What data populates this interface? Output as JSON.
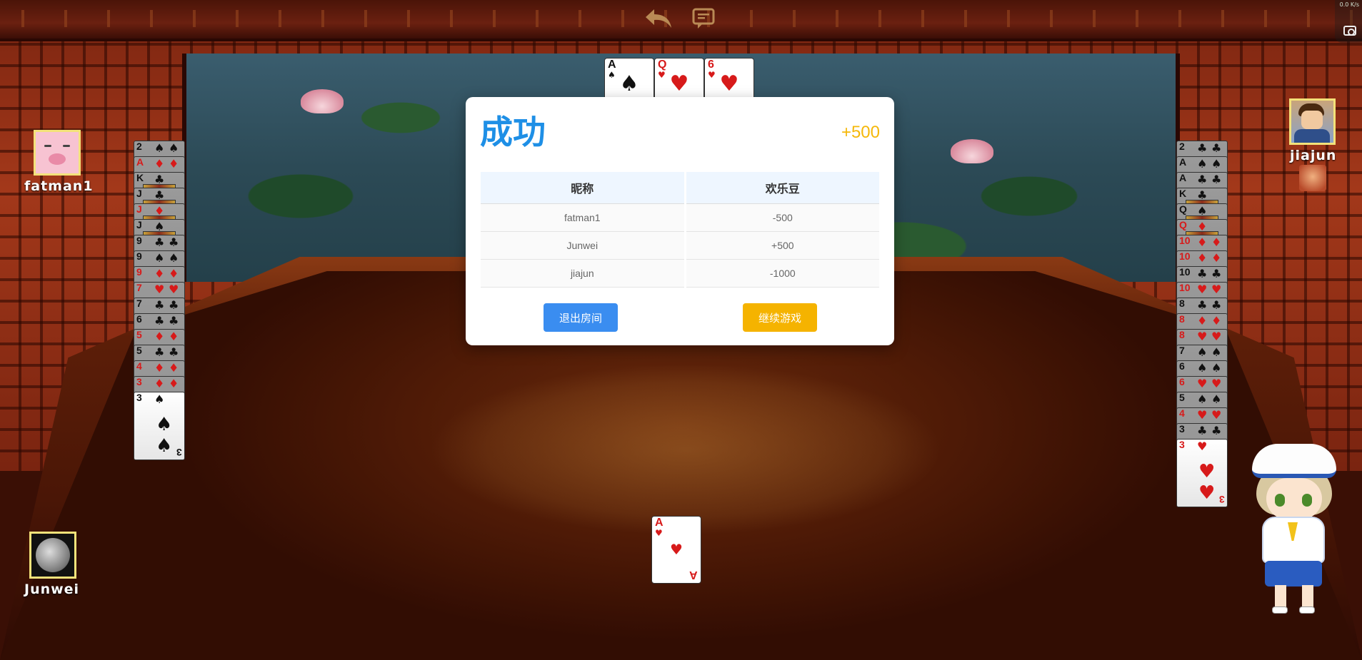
{
  "colors": {
    "title_blue": "#1e8fe6",
    "score_gold": "#f5b80a",
    "exit_button": "#3a8df0",
    "continue_button": "#f5b300",
    "avatar_frame": "#f3e27a"
  },
  "toolbar": {
    "back_icon": "undo-arrow-icon",
    "chat_icon": "chat-bubble-icon",
    "netspeed": "0.0\nK/s"
  },
  "players": {
    "left": {
      "name": "fatman1",
      "avatar": "pig"
    },
    "right": {
      "name": "jiajun",
      "avatar": "man-with-glasses"
    },
    "self": {
      "name": "Junwei",
      "avatar": "moon"
    }
  },
  "table": {
    "played_top": [
      {
        "rank": "A",
        "suit": "♠",
        "color": "black"
      },
      {
        "rank": "Q",
        "suit": "♥",
        "color": "red"
      },
      {
        "rank": "6",
        "suit": "♥",
        "color": "red"
      }
    ],
    "played_self": {
      "rank": "A",
      "suit": "♥",
      "color": "red"
    }
  },
  "left_pile": [
    {
      "rank": "2",
      "suit": "♠",
      "color": "black"
    },
    {
      "rank": "A",
      "suit": "♦",
      "color": "red"
    },
    {
      "rank": "K",
      "suit": "♣",
      "color": "black"
    },
    {
      "rank": "J",
      "suit": "♣",
      "color": "black"
    },
    {
      "rank": "J",
      "suit": "♦",
      "color": "red"
    },
    {
      "rank": "J",
      "suit": "♠",
      "color": "black"
    },
    {
      "rank": "9",
      "suit": "♣",
      "color": "black"
    },
    {
      "rank": "9",
      "suit": "♠",
      "color": "black"
    },
    {
      "rank": "9",
      "suit": "♦",
      "color": "red"
    },
    {
      "rank": "7",
      "suit": "♥",
      "color": "red"
    },
    {
      "rank": "7",
      "suit": "♣",
      "color": "black"
    },
    {
      "rank": "6",
      "suit": "♣",
      "color": "black"
    },
    {
      "rank": "5",
      "suit": "♦",
      "color": "red"
    },
    {
      "rank": "5",
      "suit": "♣",
      "color": "black"
    },
    {
      "rank": "4",
      "suit": "♦",
      "color": "red"
    },
    {
      "rank": "3",
      "suit": "♦",
      "color": "red"
    },
    {
      "rank": "3",
      "suit": "♠",
      "color": "black"
    }
  ],
  "right_pile": [
    {
      "rank": "2",
      "suit": "♣",
      "color": "black"
    },
    {
      "rank": "A",
      "suit": "♠",
      "color": "black"
    },
    {
      "rank": "A",
      "suit": "♣",
      "color": "black"
    },
    {
      "rank": "K",
      "suit": "♣",
      "color": "black"
    },
    {
      "rank": "Q",
      "suit": "♠",
      "color": "black"
    },
    {
      "rank": "Q",
      "suit": "♦",
      "color": "red"
    },
    {
      "rank": "10",
      "suit": "♦",
      "color": "red"
    },
    {
      "rank": "10",
      "suit": "♦",
      "color": "red"
    },
    {
      "rank": "10",
      "suit": "♣",
      "color": "black"
    },
    {
      "rank": "10",
      "suit": "♥",
      "color": "red"
    },
    {
      "rank": "8",
      "suit": "♣",
      "color": "black"
    },
    {
      "rank": "8",
      "suit": "♦",
      "color": "red"
    },
    {
      "rank": "8",
      "suit": "♥",
      "color": "red"
    },
    {
      "rank": "7",
      "suit": "♠",
      "color": "black"
    },
    {
      "rank": "6",
      "suit": "♠",
      "color": "black"
    },
    {
      "rank": "6",
      "suit": "♥",
      "color": "red"
    },
    {
      "rank": "5",
      "suit": "♠",
      "color": "black"
    },
    {
      "rank": "4",
      "suit": "♥",
      "color": "red"
    },
    {
      "rank": "3",
      "suit": "♣",
      "color": "black"
    },
    {
      "rank": "3",
      "suit": "♥",
      "color": "red"
    }
  ],
  "modal": {
    "title": "成功",
    "score": "+500",
    "columns": [
      "昵称",
      "欢乐豆"
    ],
    "rows": [
      [
        "fatman1",
        "-500"
      ],
      [
        "Junwei",
        "+500"
      ],
      [
        "jiajun",
        "-1000"
      ]
    ],
    "exit_label": "退出房间",
    "continue_label": "继续游戏"
  }
}
